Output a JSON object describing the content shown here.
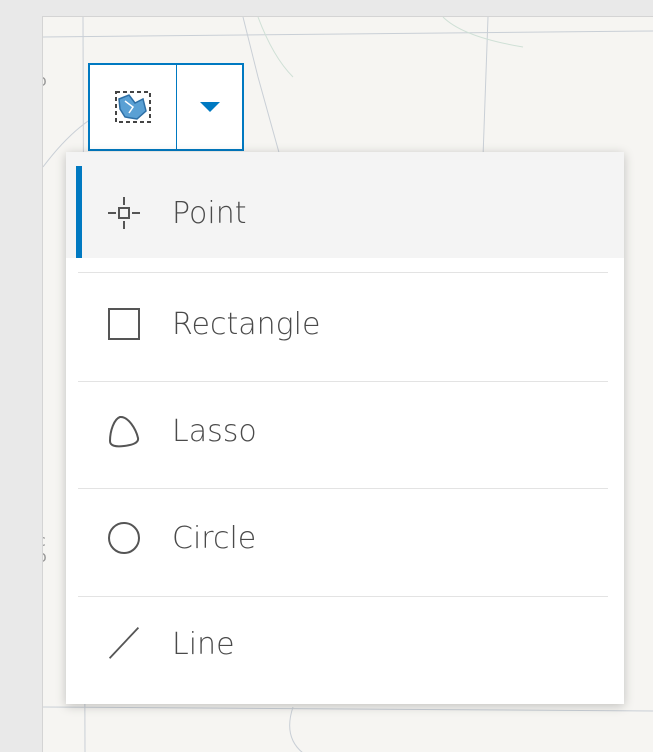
{
  "toolbar": {
    "select_icon": "select-by-rectangle-icon",
    "dropdown_icon": "caret-down-icon"
  },
  "menu": {
    "items": [
      {
        "label": "Point",
        "icon": "point-crosshair-icon",
        "selected": true
      },
      {
        "label": "Rectangle",
        "icon": "rectangle-icon",
        "selected": false
      },
      {
        "label": "Lasso",
        "icon": "lasso-icon",
        "selected": false
      },
      {
        "label": "Circle",
        "icon": "circle-icon",
        "selected": false
      },
      {
        "label": "Line",
        "icon": "line-icon",
        "selected": false
      }
    ]
  },
  "map": {
    "labels": [
      "o",
      "s",
      "c",
      "o"
    ]
  },
  "colors": {
    "accent": "#0079c1",
    "text": "#4a4a4a",
    "map_bg": "#f6f5f2"
  }
}
